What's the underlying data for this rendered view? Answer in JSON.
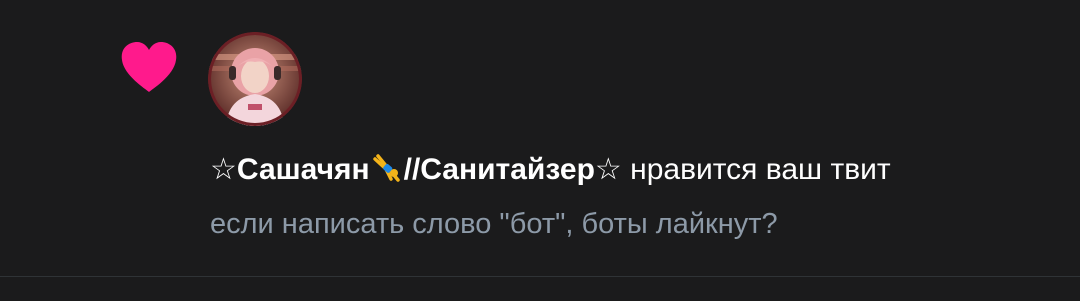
{
  "notification": {
    "icon": "heart-icon",
    "icon_color": "#ff1a8c",
    "user": {
      "star_left": "☆",
      "name_part1": "Сашачян",
      "emoji": "cartwheel-icon",
      "name_part2": "//Санитайзер",
      "star_right": "☆"
    },
    "action_text": " нравится ваш твит",
    "tweet_text": "если написать слово \"бот\", боты лайкнут?",
    "colors": {
      "background": "#1b1b1c",
      "text_primary": "#ffffff",
      "text_secondary": "#8d9aa8",
      "divider": "#2f3336"
    }
  }
}
